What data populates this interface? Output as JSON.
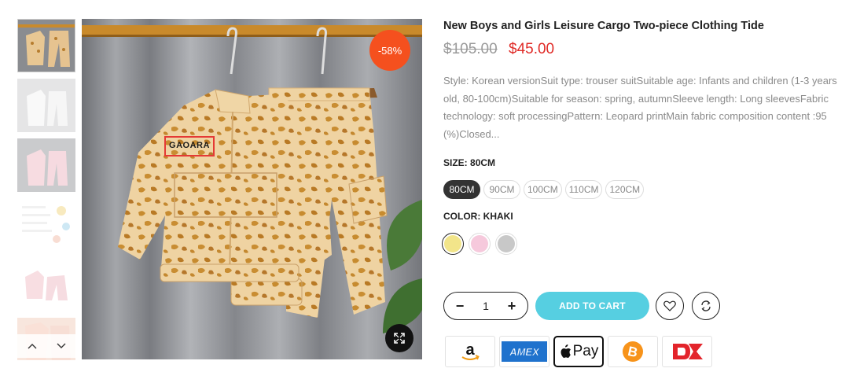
{
  "product": {
    "title": "New Boys and Girls Leisure Cargo Two-piece Clothing Tide",
    "price_old": "$105.00",
    "price_new": "$45.00",
    "discount_badge": "-58%",
    "description": "Style: Korean versionSuit type: trouser suitSuitable age: Infants and children (1-3 years old, 80-100cm)Suitable for season: spring, autumnSleeve length: Long sleevesFabric technology: soft processingPattern: Leopard printMain fabric composition content :95 (%)Closed...",
    "image_label": "GAOARA"
  },
  "size": {
    "label": "SIZE:",
    "selected": "80CM",
    "options": [
      "80CM",
      "90CM",
      "100CM",
      "110CM",
      "120CM"
    ]
  },
  "color": {
    "label": "COLOR:",
    "selected": "KHAKI",
    "swatches": [
      {
        "name": "khaki",
        "hex": "#f2e58a"
      },
      {
        "name": "pink",
        "hex": "#f6c9dc"
      },
      {
        "name": "grey",
        "hex": "#c8c8c8"
      }
    ]
  },
  "cart": {
    "quantity": "1",
    "minus": "−",
    "plus": "+",
    "add_to_cart": "ADD TO CART"
  },
  "payment": {
    "apple_pay": "Pay"
  },
  "colors": {
    "accent": "#56cfe1",
    "sale": "#f5501e",
    "price": "#e02b27"
  },
  "icons": [
    "chevron-up-icon",
    "chevron-down-icon",
    "expand-icon",
    "heart-icon",
    "compare-icon",
    "amazon-icon",
    "amex-icon",
    "apple-icon",
    "bitcoin-icon",
    "discover-icon"
  ]
}
